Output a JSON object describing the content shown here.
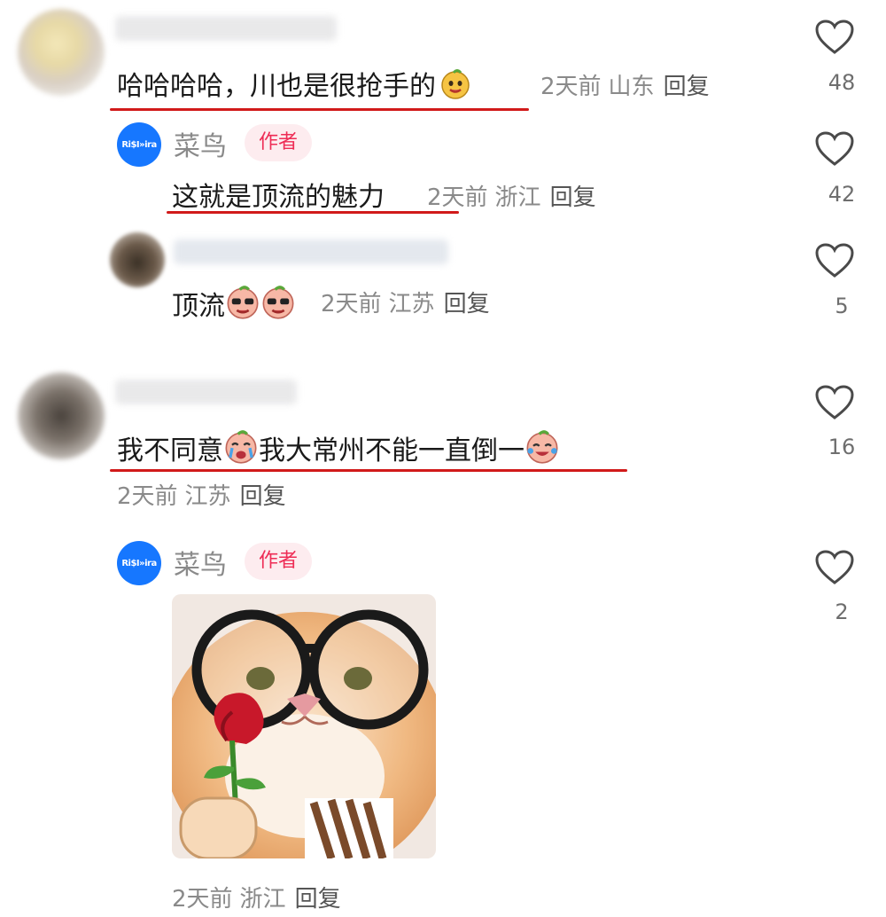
{
  "comments": [
    {
      "text": "哈哈哈哈，川也是很抢手的",
      "time": "2天前",
      "location": "山东",
      "reply_label": "回复",
      "likes": "48",
      "replies": [
        {
          "author_name": "菜鸟",
          "author_badge": "作者",
          "text": "这就是顶流的魅力",
          "time": "2天前",
          "location": "浙江",
          "reply_label": "回复",
          "likes": "42"
        },
        {
          "text": "顶流",
          "time": "2天前",
          "location": "江苏",
          "reply_label": "回复",
          "likes": "5"
        }
      ]
    },
    {
      "text_part1": "我不同意",
      "text_part2": "我大常州不能一直倒一",
      "time": "2天前",
      "location": "江苏",
      "reply_label": "回复",
      "likes": "16",
      "replies": [
        {
          "author_name": "菜鸟",
          "author_badge": "作者",
          "time": "2天前",
          "location": "浙江",
          "reply_label": "回复",
          "likes": "2"
        }
      ]
    }
  ],
  "author_avatar_text": "Ri$I»ira",
  "colors": {
    "accent_badge": "#ee2c55",
    "badge_bg": "#fdecef",
    "avatar_blue": "#1677ff",
    "underline": "#d11a1a"
  }
}
